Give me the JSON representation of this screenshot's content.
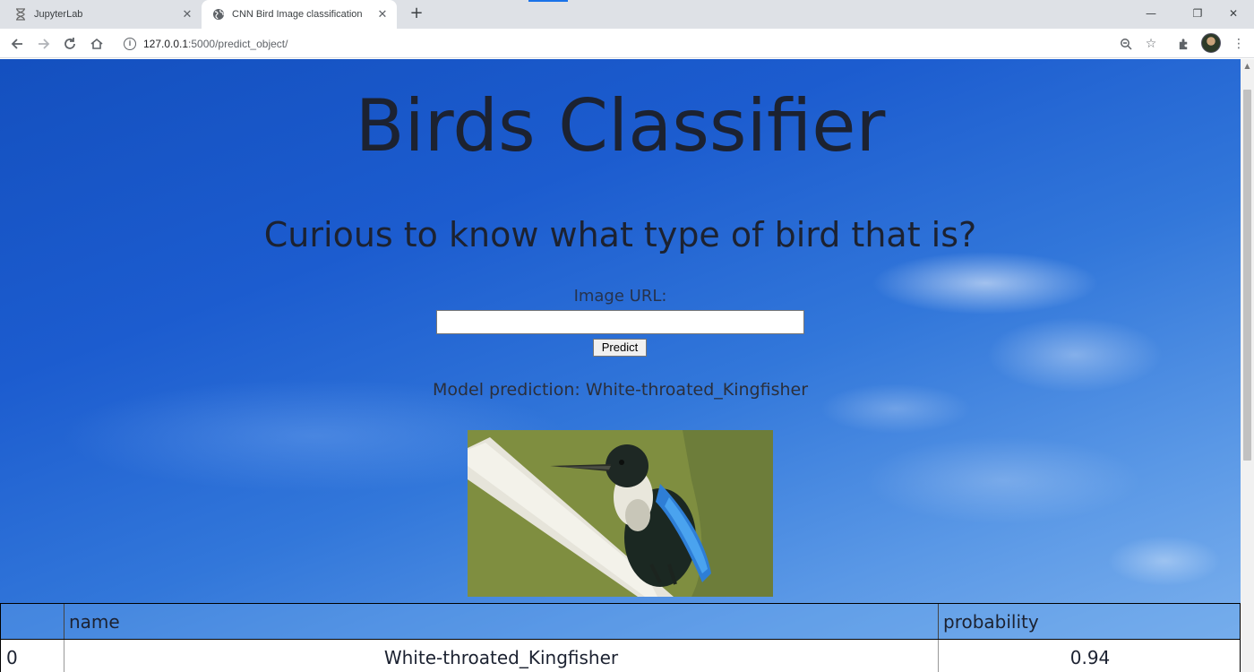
{
  "browser": {
    "tabs": [
      {
        "title": "JupyterLab",
        "icon": "hourglass-icon",
        "active": false
      },
      {
        "title": "CNN Bird Image classification",
        "icon": "globe-icon",
        "active": true
      }
    ],
    "url_host": "127.0.0.1",
    "url_path": ":5000/predict_object/"
  },
  "page": {
    "title": "Birds Classifier",
    "subtitle": "Curious to know what type of bird that is?",
    "url_label": "Image URL:",
    "url_value": "",
    "predict_label": "Predict",
    "prediction_text": "Model prediction: White-throated_Kingfisher"
  },
  "results": {
    "columns": [
      "",
      "name",
      "probability"
    ],
    "rows": [
      {
        "index": "0",
        "name": "White-throated_Kingfisher",
        "probability": "0.94"
      }
    ]
  },
  "colors": {
    "accent": "#1a73e8",
    "heading": "#1c2231",
    "sky_dark": "#1450bf",
    "sky_light": "#7fb3ee"
  }
}
